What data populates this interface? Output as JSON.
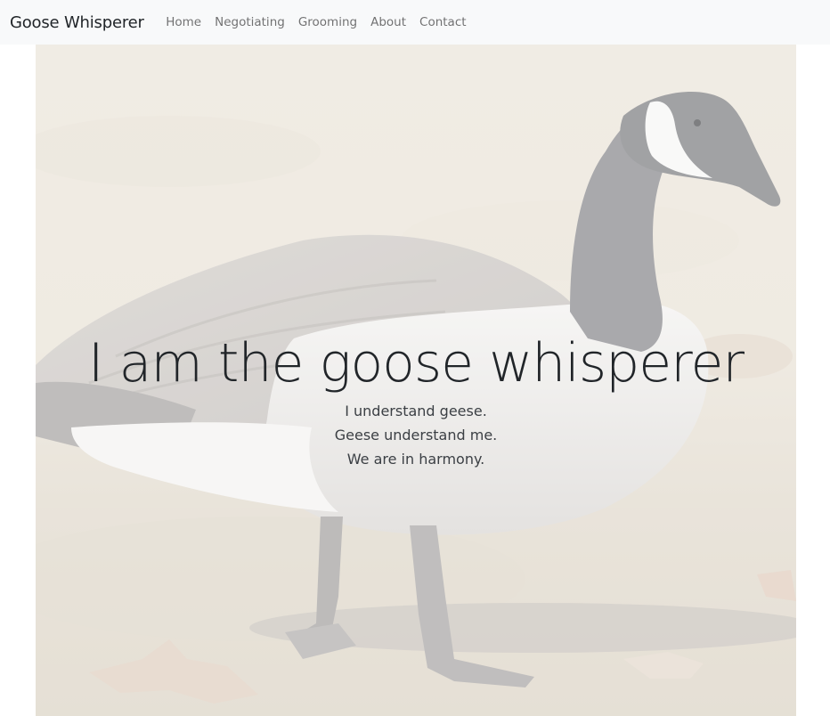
{
  "navbar": {
    "brand": "Goose Whisperer",
    "links": [
      "Home",
      "Negotiating",
      "Grooming",
      "About",
      "Contact"
    ]
  },
  "hero": {
    "title": "I am the goose whisperer",
    "lines": [
      "I understand geese.",
      "Geese understand me.",
      "We are in harmony."
    ],
    "image_subject": "canada-goose-photo"
  }
}
